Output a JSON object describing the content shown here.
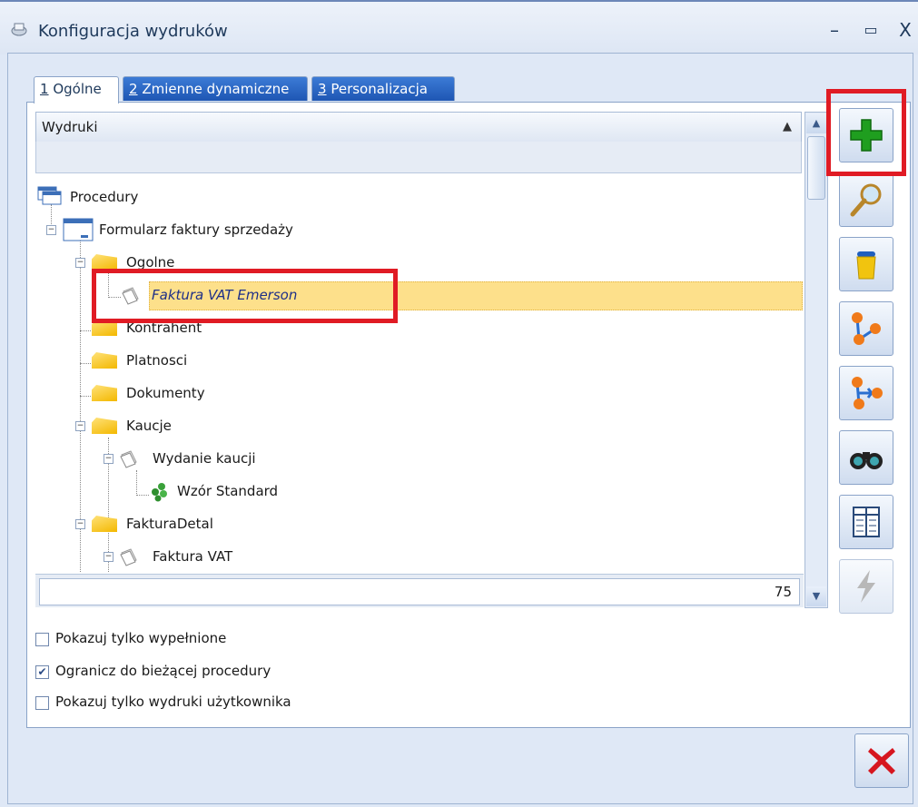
{
  "window": {
    "title": "Konfiguracja wydruków",
    "minimize": "–",
    "maximize": "▭",
    "close": "X"
  },
  "tabs": [
    {
      "key": "1",
      "label": "Ogólne",
      "active": true
    },
    {
      "key": "2",
      "label": "Zmienne dynamiczne",
      "active": false
    },
    {
      "key": "3",
      "label": "Personalizacja",
      "active": false
    }
  ],
  "grid": {
    "header": "Wydruki",
    "footer_count": "75"
  },
  "tree": [
    {
      "label": "Procedury",
      "icon": "procedures-icon"
    },
    {
      "label": "Formularz faktury sprzedaży",
      "icon": "form-icon"
    },
    {
      "label": "Ogolne",
      "icon": "folder-icon"
    },
    {
      "label": "Faktura VAT Emerson",
      "icon": "document-icon",
      "selected": true
    },
    {
      "label": "Kontrahent",
      "icon": "folder-icon"
    },
    {
      "label": "Platnosci",
      "icon": "folder-icon"
    },
    {
      "label": "Dokumenty",
      "icon": "folder-icon"
    },
    {
      "label": "Kaucje",
      "icon": "folder-icon"
    },
    {
      "label": "Wydanie kaucji",
      "icon": "document-icon"
    },
    {
      "label": "Wzór Standard",
      "icon": "template-icon"
    },
    {
      "label": "FakturaDetal",
      "icon": "folder-icon"
    },
    {
      "label": "Faktura VAT",
      "icon": "document-icon"
    }
  ],
  "toolbar": [
    "add-icon",
    "edit-icon",
    "delete-icon",
    "copy-icon",
    "move-icon",
    "search-icon",
    "columns-icon",
    "lightning-icon"
  ],
  "options": {
    "show_filled": {
      "label": "Pokazuj tylko wypełnione",
      "checked": false
    },
    "limit_procedure": {
      "label": "Ogranicz do bieżącej procedury",
      "checked": true
    },
    "show_user_prints": {
      "label": "Pokazuj tylko wydruki użytkownika",
      "checked": false
    }
  },
  "colors": {
    "selection": "#fde08b",
    "highlight": "#e01b24",
    "add": "#1f9e1f",
    "close": "#d6161f"
  }
}
